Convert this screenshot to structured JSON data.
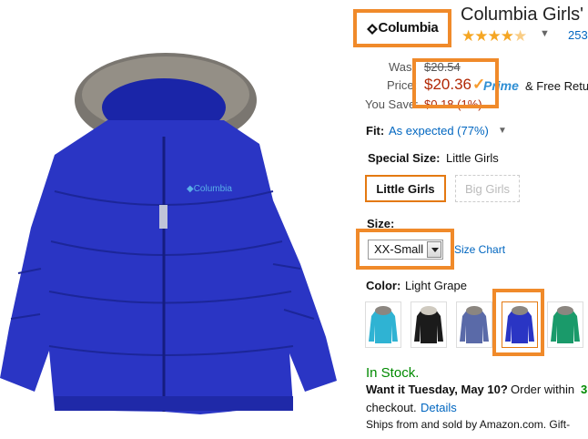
{
  "brand": {
    "logo_text": "Columbia"
  },
  "product": {
    "title": "Columbia Girls'",
    "rating_stars": 4.5,
    "rating_count": "253"
  },
  "pricing": {
    "was_label": "Was:",
    "was_value": "$20.54",
    "price_label": "Price:",
    "price_value": "$20.36",
    "prime_label": "Prime",
    "free_returns": "& Free Retu",
    "save_label": "You Save:",
    "save_value": "$0.18 (1%)"
  },
  "fit": {
    "label": "Fit:",
    "value": "As expected (77%)"
  },
  "special_size": {
    "label": "Special Size:",
    "value": "Little Girls",
    "options": [
      {
        "label": "Little Girls",
        "selected": true
      },
      {
        "label": "Big Girls",
        "selected": false
      }
    ]
  },
  "size": {
    "label": "Size:",
    "selected": "XX-Small",
    "chart_link": "Size Chart"
  },
  "color": {
    "label": "Color:",
    "value": "Light Grape",
    "swatches": [
      {
        "name": "teal",
        "hex": "#2fb3d3"
      },
      {
        "name": "black",
        "hex": "#1b1b1b"
      },
      {
        "name": "slate-blue",
        "hex": "#5a6aa8"
      },
      {
        "name": "light-grape",
        "hex": "#2a35c4"
      },
      {
        "name": "green",
        "hex": "#1a9a6a"
      }
    ],
    "selected_index": 3
  },
  "stock": {
    "status": "In Stock.",
    "want_it": "Want it Tuesday, May 10?",
    "order_within": "Order within",
    "countdown": "3",
    "checkout": "checkout.",
    "details_link": "Details",
    "ships_from": "Ships from and sold by Amazon.com. Gift-"
  },
  "colors": {
    "highlight": "#f08a2a",
    "link": "#0066c0",
    "price": "#b12704",
    "in_stock": "#008a00",
    "jacket": "#2a35c4"
  }
}
